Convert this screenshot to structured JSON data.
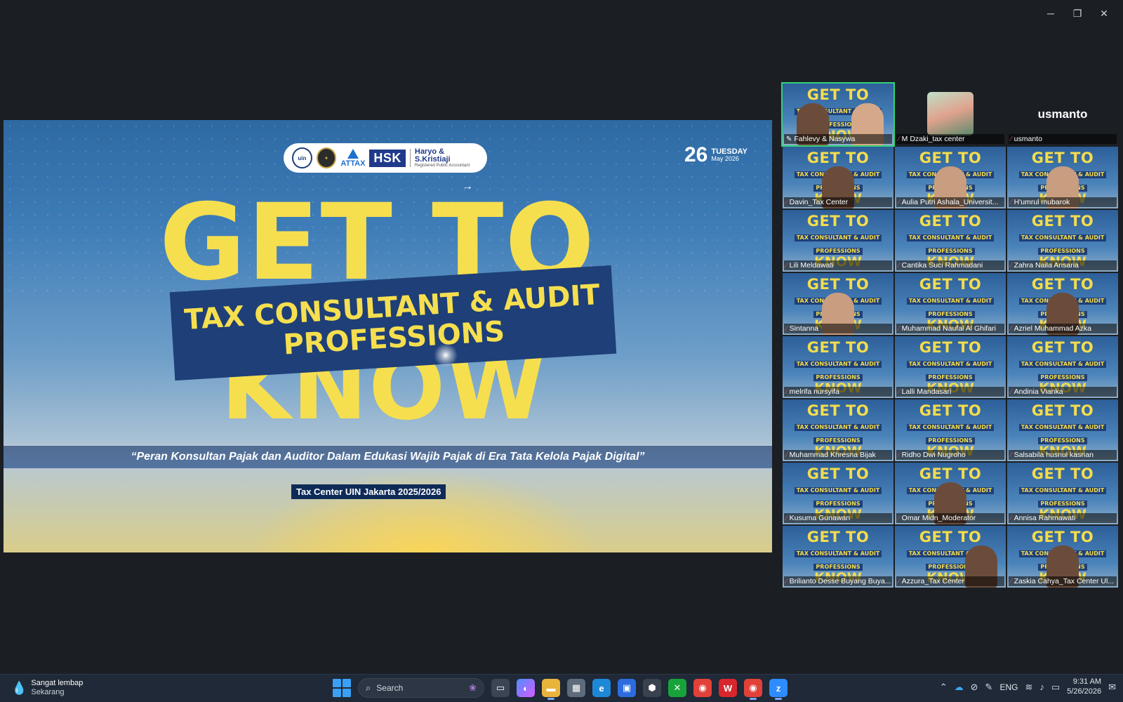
{
  "window": {
    "minimize_icon": "minimize-icon",
    "restore_icon": "restore-icon",
    "close_icon": "close-icon",
    "minimize_glyph": "─",
    "restore_glyph": "❐",
    "close_glyph": "✕"
  },
  "slide": {
    "logos": {
      "uin": "uin",
      "attax": "ATTAX",
      "hsk": "HSK",
      "firm_name": "Haryo & S.Kristiaji",
      "firm_sub": "Registered Public Accountant"
    },
    "date": {
      "day": "26",
      "weekday": "TUESDAY",
      "month_year": "May 2026"
    },
    "headline_top": "GET TO",
    "banner_line1": "TAX CONSULTANT & AUDIT",
    "banner_line2": "PROFESSIONS",
    "headline_bottom": "KNOW",
    "quote": "“Peran Konsultan Pajak dan Auditor Dalam Edukasi Wajib Pajak di Era Tata Kelola Pajak Digital”",
    "tag": "Tax Center UIN Jakarta 2025/2026",
    "cursor": "→"
  },
  "tile_slide": {
    "g": "GET TO",
    "m1": "TAX CONSULTANT & AUDIT",
    "m2": "PROFESSIONS",
    "k": "KNOW"
  },
  "participants": [
    "Fahlevy & Nasywa",
    "M Dzaki_tax center",
    "usmanto",
    "Davin_Tax Center",
    "Aulia Putri Ashala_Universit...",
    "H'umrul mubarok",
    "Lili Meldawati",
    "Cantika Suci Rahmadani",
    "Zahra Naila Ansaria",
    "Sintanna",
    "Muhammad Naufal Al Ghifari",
    "Azriel Muhammad Azka",
    "melrifa nursyifa",
    "Lalli Mandasari",
    "Andinia Vianka",
    "Muhammad Khresna Bijak",
    "Ridho Dwi Nugroho",
    "Salsabila husnul kasrian",
    "Kusuma Gunawan",
    "Omar Midn_Moderator",
    "Annisa Rahmawati",
    "Brilianto Desse Buyang Buya...",
    "Azzura_Tax Center",
    "Zaskia Cahya_Tax Center Ul..."
  ],
  "plain_tile_name": "usmanto",
  "taskbar": {
    "weather_title": "Sangat lembap",
    "weather_sub": "Sekarang",
    "search_placeholder": "Search",
    "lang": "ENG",
    "time": "9:31 AM",
    "date": "5/26/2026"
  }
}
